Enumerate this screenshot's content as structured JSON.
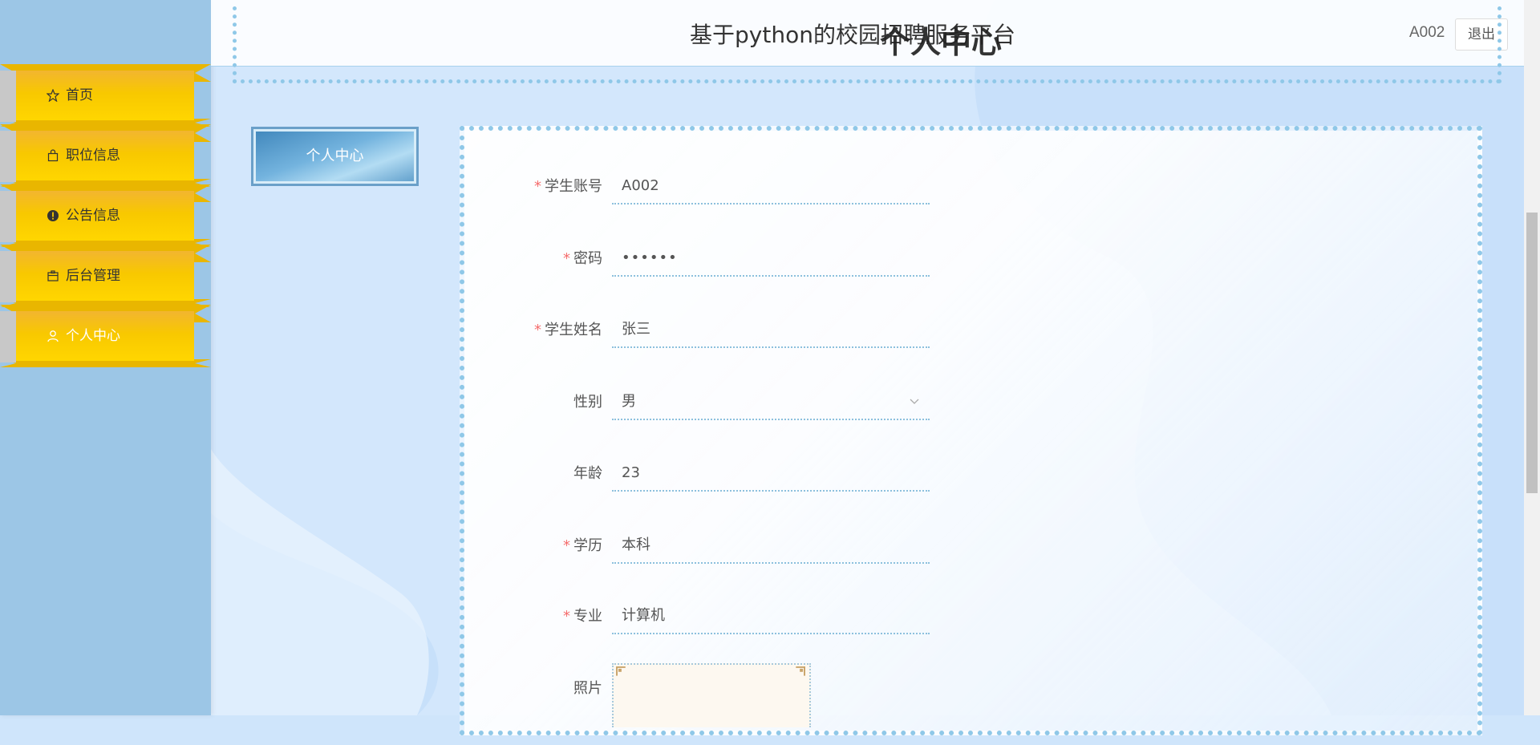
{
  "header": {
    "site_title": "基于python的校园招聘服务平台",
    "page_title": "个人中心",
    "user_name": "A002",
    "logout_label": "退出"
  },
  "sidebar": {
    "items": [
      {
        "label": "首页",
        "icon": "star-icon"
      },
      {
        "label": "职位信息",
        "icon": "bag-icon"
      },
      {
        "label": "公告信息",
        "icon": "alert-icon"
      },
      {
        "label": "后台管理",
        "icon": "box-icon"
      },
      {
        "label": "个人中心",
        "icon": "user-icon",
        "active": true
      }
    ]
  },
  "side_tab": {
    "label": "个人中心"
  },
  "form": {
    "fields": [
      {
        "label": "学生账号",
        "required": true,
        "value": "A002"
      },
      {
        "label": "密码",
        "required": true,
        "value": "••••••"
      },
      {
        "label": "学生姓名",
        "required": true,
        "value": "张三"
      },
      {
        "label": "性别",
        "required": false,
        "value": "男",
        "type": "select"
      },
      {
        "label": "年龄",
        "required": false,
        "value": "23"
      },
      {
        "label": "学历",
        "required": true,
        "value": "本科"
      },
      {
        "label": "专业",
        "required": true,
        "value": "计算机"
      },
      {
        "label": "照片",
        "required": false,
        "type": "image"
      }
    ]
  },
  "colors": {
    "sidebar_bg": "#9cc6e6",
    "menu_gold": "#f5c400",
    "accent_blue": "#8fc8e8",
    "required_red": "#f56c6c"
  }
}
